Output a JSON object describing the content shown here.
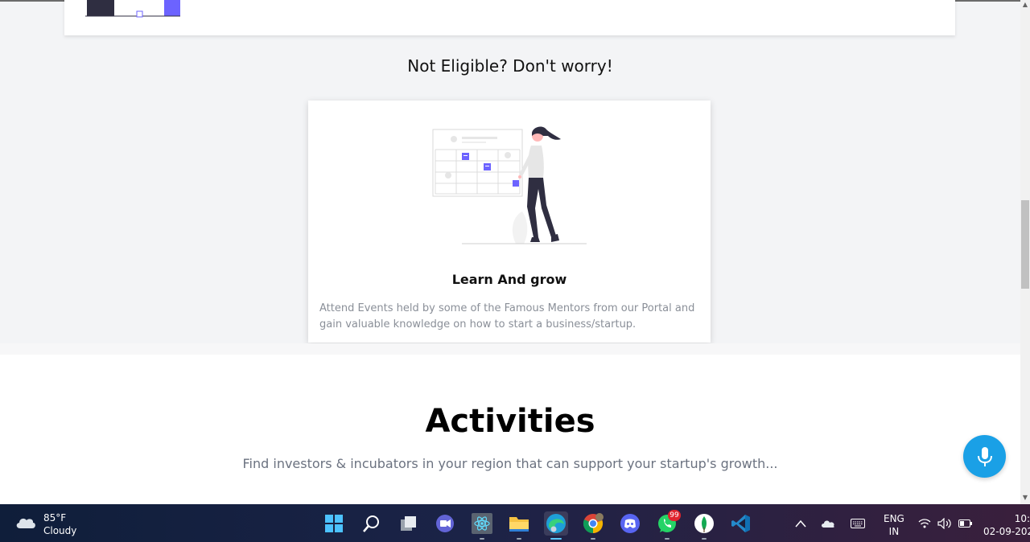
{
  "page": {
    "not_eligible_heading": "Not Eligible? Don't worry!",
    "learn_card": {
      "title": "Learn And grow",
      "description": "Attend Events held by some of the Famous Mentors from our Portal and gain valuable knowledge on how to start a business/startup."
    },
    "activities": {
      "title": "Activities",
      "subtitle": "Find investors & incubators in your region that can support your startup's growth..."
    }
  },
  "colors": {
    "accent_blue": "#1aa0e6",
    "illustration_purple": "#6c63ff",
    "background": "#f3f4f6"
  },
  "taskbar": {
    "weather": {
      "temp": "85°F",
      "condition": "Cloudy",
      "icon": "cloud-icon"
    },
    "apps": [
      {
        "name": "windows-start-icon"
      },
      {
        "name": "search-icon"
      },
      {
        "name": "task-view-icon"
      },
      {
        "name": "teams-chat-icon"
      },
      {
        "name": "react-devtools-icon"
      },
      {
        "name": "file-explorer-icon"
      },
      {
        "name": "edge-browser-icon"
      },
      {
        "name": "chrome-browser-icon"
      },
      {
        "name": "discord-icon"
      },
      {
        "name": "whatsapp-icon",
        "badge": "99"
      },
      {
        "name": "mongodb-compass-icon"
      },
      {
        "name": "vscode-icon"
      }
    ],
    "tray": {
      "lang_top": "ENG",
      "lang_bottom": "IN",
      "time": "10:",
      "date": "02-09-202"
    }
  }
}
